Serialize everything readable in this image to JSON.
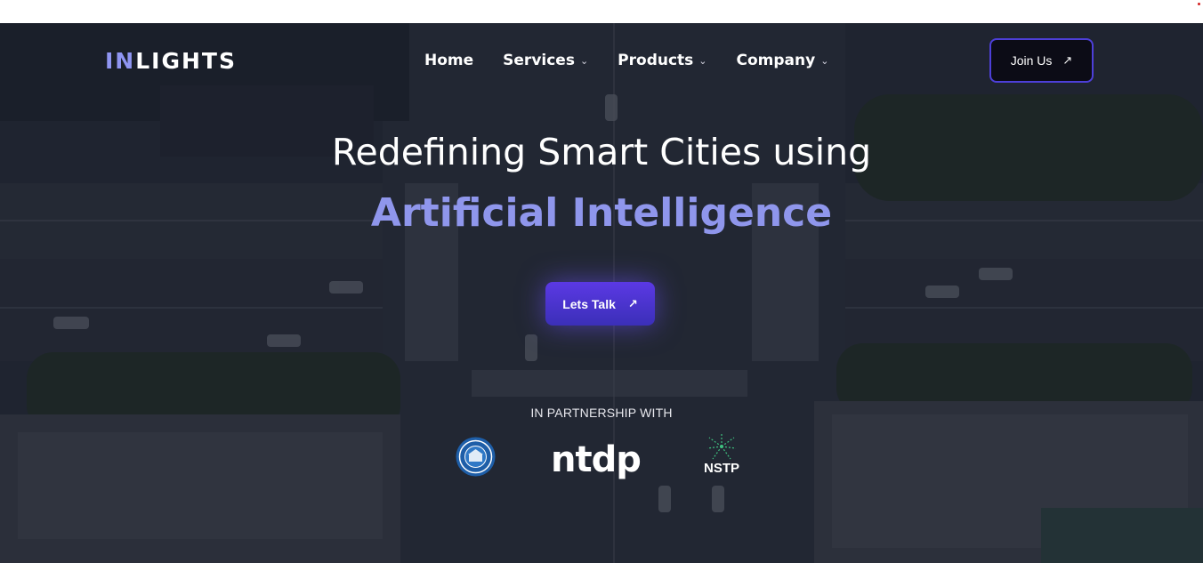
{
  "header": {
    "logo": {
      "part_accent": "IN",
      "part_main": "LIGHTS"
    },
    "nav": [
      {
        "label": "Home",
        "has_dropdown": false
      },
      {
        "label": "Services",
        "has_dropdown": true
      },
      {
        "label": "Products",
        "has_dropdown": true
      },
      {
        "label": "Company",
        "has_dropdown": true
      }
    ],
    "join_button": {
      "label": "Join Us",
      "icon": "arrow-up-right-icon"
    }
  },
  "hero": {
    "headline": "Redefining Smart Cities using",
    "subheadline": "Artificial Intelligence",
    "cta": {
      "label": "Lets Talk",
      "icon": "arrow-up-right-icon"
    }
  },
  "partners": {
    "label": "IN PARTNERSHIP WITH",
    "logos": [
      {
        "name": "university-seal-logo"
      },
      {
        "text": "ntdp"
      },
      {
        "text": "NSTP"
      }
    ]
  },
  "colors": {
    "accent": "#8f96ec",
    "cta": "#4a34d4",
    "join_border": "#4d3fd8",
    "overlay": "#1f2430"
  }
}
